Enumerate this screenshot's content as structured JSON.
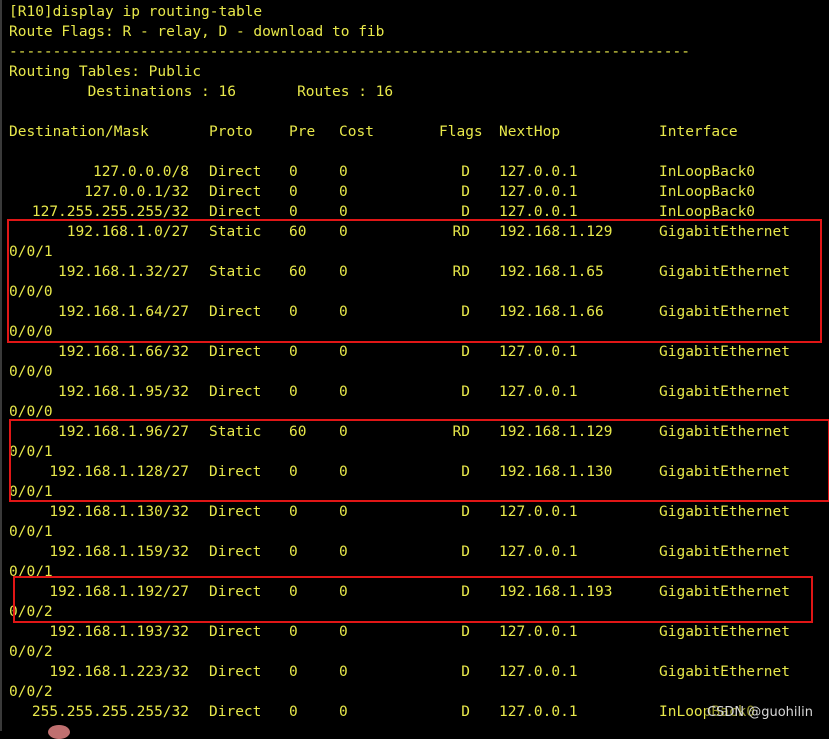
{
  "terminal": {
    "command_line": "[R10]display ip routing-table",
    "flags_line": "Route Flags: R - relay, D - download to fib",
    "separator": "------------------------------------------------------------------------------",
    "tables_line": "Routing Tables: Public",
    "summary_line": "         Destinations : 16       Routes : 16",
    "headers": {
      "dest": "Destination/Mask",
      "proto": "Proto",
      "pre": "Pre",
      "cost": "Cost",
      "flags": "Flags",
      "nexthop": "NextHop",
      "iface": "Interface"
    },
    "routes": [
      {
        "dest": "127.0.0.0/8",
        "proto": "Direct",
        "pre": "0",
        "cost": "0",
        "flags": "D",
        "nexthop": "127.0.0.1",
        "iface": "InLoopBack0",
        "wrap": ""
      },
      {
        "dest": "127.0.0.1/32",
        "proto": "Direct",
        "pre": "0",
        "cost": "0",
        "flags": "D",
        "nexthop": "127.0.0.1",
        "iface": "InLoopBack0",
        "wrap": ""
      },
      {
        "dest": "127.255.255.255/32",
        "proto": "Direct",
        "pre": "0",
        "cost": "0",
        "flags": "D",
        "nexthop": "127.0.0.1",
        "iface": "InLoopBack0",
        "wrap": ""
      },
      {
        "dest": "192.168.1.0/27",
        "proto": "Static",
        "pre": "60",
        "cost": "0",
        "flags": "RD",
        "nexthop": "192.168.1.129",
        "iface": "GigabitEthernet",
        "wrap": "0/0/1"
      },
      {
        "dest": "192.168.1.32/27",
        "proto": "Static",
        "pre": "60",
        "cost": "0",
        "flags": "RD",
        "nexthop": "192.168.1.65",
        "iface": "GigabitEthernet",
        "wrap": "0/0/0"
      },
      {
        "dest": "192.168.1.64/27",
        "proto": "Direct",
        "pre": "0",
        "cost": "0",
        "flags": "D",
        "nexthop": "192.168.1.66",
        "iface": "GigabitEthernet",
        "wrap": "0/0/0"
      },
      {
        "dest": "192.168.1.66/32",
        "proto": "Direct",
        "pre": "0",
        "cost": "0",
        "flags": "D",
        "nexthop": "127.0.0.1",
        "iface": "GigabitEthernet",
        "wrap": "0/0/0"
      },
      {
        "dest": "192.168.1.95/32",
        "proto": "Direct",
        "pre": "0",
        "cost": "0",
        "flags": "D",
        "nexthop": "127.0.0.1",
        "iface": "GigabitEthernet",
        "wrap": "0/0/0"
      },
      {
        "dest": "192.168.1.96/27",
        "proto": "Static",
        "pre": "60",
        "cost": "0",
        "flags": "RD",
        "nexthop": "192.168.1.129",
        "iface": "GigabitEthernet",
        "wrap": "0/0/1"
      },
      {
        "dest": "192.168.1.128/27",
        "proto": "Direct",
        "pre": "0",
        "cost": "0",
        "flags": "D",
        "nexthop": "192.168.1.130",
        "iface": "GigabitEthernet",
        "wrap": "0/0/1"
      },
      {
        "dest": "192.168.1.130/32",
        "proto": "Direct",
        "pre": "0",
        "cost": "0",
        "flags": "D",
        "nexthop": "127.0.0.1",
        "iface": "GigabitEthernet",
        "wrap": "0/0/1"
      },
      {
        "dest": "192.168.1.159/32",
        "proto": "Direct",
        "pre": "0",
        "cost": "0",
        "flags": "D",
        "nexthop": "127.0.0.1",
        "iface": "GigabitEthernet",
        "wrap": "0/0/1"
      },
      {
        "dest": "192.168.1.192/27",
        "proto": "Direct",
        "pre": "0",
        "cost": "0",
        "flags": "D",
        "nexthop": "192.168.1.193",
        "iface": "GigabitEthernet",
        "wrap": "0/0/2"
      },
      {
        "dest": "192.168.1.193/32",
        "proto": "Direct",
        "pre": "0",
        "cost": "0",
        "flags": "D",
        "nexthop": "127.0.0.1",
        "iface": "GigabitEthernet",
        "wrap": "0/0/2"
      },
      {
        "dest": "192.168.1.223/32",
        "proto": "Direct",
        "pre": "0",
        "cost": "0",
        "flags": "D",
        "nexthop": "127.0.0.1",
        "iface": "GigabitEthernet",
        "wrap": "0/0/2"
      },
      {
        "dest": "255.255.255.255/32",
        "proto": "Direct",
        "pre": "0",
        "cost": "0",
        "flags": "D",
        "nexthop": "127.0.0.1",
        "iface": "InLoopBack0",
        "wrap": ""
      }
    ]
  },
  "watermark": "CSDN @guohilin",
  "colors": {
    "background": "#000000",
    "text": "#e8e84a",
    "highlight_box": "#e01616"
  }
}
